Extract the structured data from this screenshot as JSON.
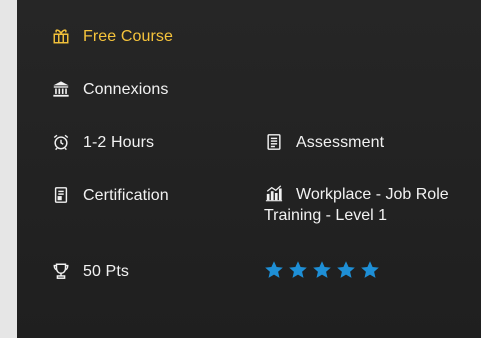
{
  "items": {
    "free_course": "Free Course",
    "provider": "Connexions",
    "duration": "1-2 Hours",
    "assessment": "Assessment",
    "certification": "Certification",
    "category": "Workplace - Job Role Training - Level 1",
    "points": "50 Pts"
  },
  "icons": {
    "free_course": "gift-icon",
    "provider": "institution-icon",
    "duration": "alarm-clock-icon",
    "assessment": "document-icon",
    "certification": "certificate-icon",
    "category": "chart-icon",
    "points": "trophy-icon"
  },
  "rating": {
    "value": 5,
    "max": 5
  },
  "colors": {
    "accent": "#f5c33b",
    "star": "#1e8fd6",
    "text": "#f2f2f2",
    "card_bg": "#232323"
  }
}
